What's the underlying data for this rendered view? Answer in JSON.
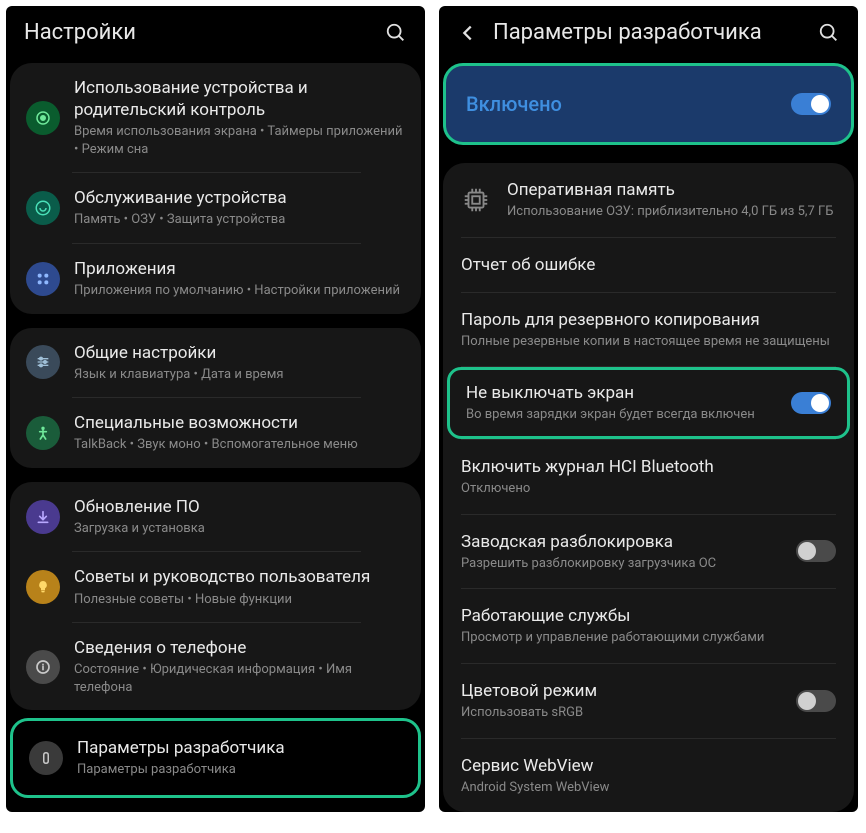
{
  "left": {
    "title": "Настройки",
    "groups": [
      [
        {
          "id": "wellbeing",
          "title": "Использование устройства и родительский контроль",
          "sub": "Время использования экрана • Таймеры приложений • Режим сна"
        },
        {
          "id": "care",
          "title": "Обслуживание устройства",
          "sub": "Память • ОЗУ • Защита устройства"
        },
        {
          "id": "apps",
          "title": "Приложения",
          "sub": "Приложения по умолчанию • Настройки приложений"
        }
      ],
      [
        {
          "id": "general",
          "title": "Общие настройки",
          "sub": "Язык и клавиатура • Дата и время"
        },
        {
          "id": "access",
          "title": "Специальные возможности",
          "sub": "TalkBack • Звук моно • Вспомогательное меню"
        }
      ],
      [
        {
          "id": "update",
          "title": "Обновление ПО",
          "sub": "Загрузка и установка"
        },
        {
          "id": "tips",
          "title": "Советы и руководство пользователя",
          "sub": "Полезные советы • Новые функции"
        },
        {
          "id": "about",
          "title": "Сведения о телефоне",
          "sub": "Состояние • Юридическая информация • Имя телефона"
        }
      ]
    ],
    "developer": {
      "id": "dev",
      "title": "Параметры разработчика",
      "sub": "Параметры разработчика"
    }
  },
  "right": {
    "title": "Параметры разработчика",
    "enabled_label": "Включено",
    "memory": {
      "title": "Оперативная память",
      "sub": "Использование ОЗУ: приблизительно 4,0 ГБ из 5,7 ГБ"
    },
    "items": [
      {
        "title": "Отчет об ошибке",
        "sub": "",
        "toggle": null
      },
      {
        "title": "Пароль для резервного копирования",
        "sub": "Полные резервные копии в настоящее время не защищены",
        "toggle": null
      },
      {
        "title": "Не выключать экран",
        "sub": "Во время зарядки экран будет всегда включен",
        "toggle": true,
        "highlight": true
      },
      {
        "title": "Включить журнал HCI Bluetooth",
        "sub": "Отключено",
        "toggle": null
      },
      {
        "title": "Заводская разблокировка",
        "sub": "Разрешить разблокировку загрузчика ОС",
        "toggle": false
      },
      {
        "title": "Работающие службы",
        "sub": "Просмотр и управление работающими службами",
        "toggle": null
      },
      {
        "title": "Цветовой режим",
        "sub": "Использовать sRGB",
        "toggle": false
      },
      {
        "title": "Сервис WebView",
        "sub": "Android System WebView",
        "toggle": null
      }
    ]
  }
}
